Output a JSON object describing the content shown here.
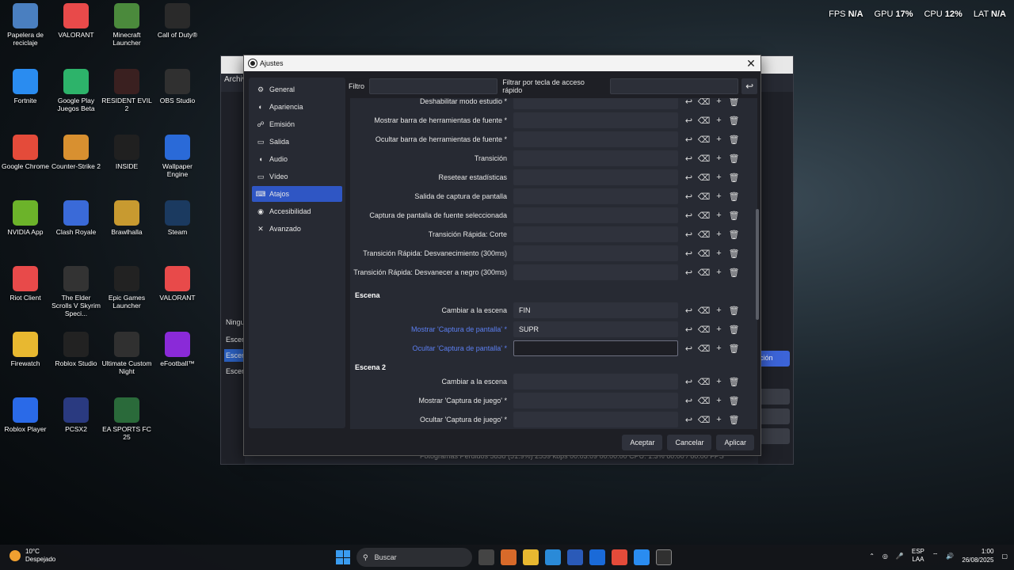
{
  "desktop": {
    "icons": [
      {
        "label": "Papelera de reciclaje",
        "color": "#4a7fc0"
      },
      {
        "label": "VALORANT",
        "color": "#e84a4a"
      },
      {
        "label": "Minecraft Launcher",
        "color": "#4b8a3c"
      },
      {
        "label": "Call of Duty®",
        "color": "#2a2a2a"
      },
      {
        "label": "Fortnite",
        "color": "#2a8cf0"
      },
      {
        "label": "Google Play Juegos Beta",
        "color": "#2db36a"
      },
      {
        "label": "RESIDENT EVIL 2",
        "color": "#3a2020"
      },
      {
        "label": "OBS Studio",
        "color": "#303030"
      },
      {
        "label": "Google Chrome",
        "color": "#e44b3a"
      },
      {
        "label": "Counter-Strike 2",
        "color": "#d89030"
      },
      {
        "label": "INSIDE",
        "color": "#202020"
      },
      {
        "label": "Wallpaper Engine",
        "color": "#2a6ad8"
      },
      {
        "label": "NVIDIA App",
        "color": "#6cb32a"
      },
      {
        "label": "Clash Royale",
        "color": "#3a6ad8"
      },
      {
        "label": "Brawlhalla",
        "color": "#c89a30"
      },
      {
        "label": "Steam",
        "color": "#1b3a60"
      },
      {
        "label": "Riot Client",
        "color": "#e84a4a"
      },
      {
        "label": "The Elder Scrolls V Skyrim Speci...",
        "color": "#333333"
      },
      {
        "label": "Epic Games Launcher",
        "color": "#222222"
      },
      {
        "label": "VALORANT",
        "color": "#e84a4a"
      },
      {
        "label": "Firewatch",
        "color": "#e8b830"
      },
      {
        "label": "Roblox Studio",
        "color": "#222222"
      },
      {
        "label": "Ultimate Custom Night",
        "color": "#303030"
      },
      {
        "label": "eFootball™",
        "color": "#8a2ad8"
      },
      {
        "label": "Roblox Player",
        "color": "#2a6ae8"
      },
      {
        "label": "PCSX2",
        "color": "#2a3a80"
      },
      {
        "label": "EA SPORTS FC 25",
        "color": "#2a6a3a"
      }
    ]
  },
  "perf": {
    "fps_label": "FPS",
    "fps_val": "N/A",
    "gpu_label": "GPU",
    "gpu_val": "17%",
    "cpu_label": "CPU",
    "cpu_val": "12%",
    "lat_label": "LAT",
    "lat_val": "N/A"
  },
  "obs_main": {
    "menu": "Archiv",
    "scenes_label": "Escen",
    "ninguna": "Ningu",
    "scene_items": [
      "Escen",
      "Escen"
    ],
    "action_btn": "ción",
    "status": "Fotogramas Perdidos 5838 (51.9%)    2559 kbps    00:03:09    00:00:00    CPU: 1.3%    60.00 / 60.00 FPS"
  },
  "dialog": {
    "title": "Ajustes",
    "close": "✕",
    "sidebar": [
      {
        "label": "General",
        "icon": "gear-icon"
      },
      {
        "label": "Apariencia",
        "icon": "palette-icon"
      },
      {
        "label": "Emisión",
        "icon": "broadcast-icon"
      },
      {
        "label": "Salida",
        "icon": "output-icon"
      },
      {
        "label": "Audio",
        "icon": "speaker-icon"
      },
      {
        "label": "Vídeo",
        "icon": "monitor-icon"
      },
      {
        "label": "Atajos",
        "icon": "keyboard-icon"
      },
      {
        "label": "Accesibilidad",
        "icon": "accessibility-icon"
      },
      {
        "label": "Avanzado",
        "icon": "tools-icon"
      }
    ],
    "active_section": "Atajos",
    "filter_label": "Filtro",
    "filter_hotkey_label": "Filtrar por tecla de acceso rápido",
    "hotkeys": [
      {
        "label": "Deshabilitar modo estudio *",
        "key": ""
      },
      {
        "label": "Mostrar barra de herramientas de fuente *",
        "key": ""
      },
      {
        "label": "Ocultar barra de herramientas de fuente *",
        "key": ""
      },
      {
        "label": "Transición",
        "key": ""
      },
      {
        "label": "Resetear estadísticas",
        "key": ""
      },
      {
        "label": "Salida de captura de pantalla",
        "key": ""
      },
      {
        "label": "Captura de pantalla de fuente seleccionada",
        "key": ""
      },
      {
        "label": "Transición Rápida: Corte",
        "key": ""
      },
      {
        "label": "Transición Rápida: Desvanecimiento (300ms)",
        "key": ""
      },
      {
        "label": "Transición Rápida: Desvanecer a negro (300ms)",
        "key": ""
      }
    ],
    "section_escena": {
      "title": "Escena",
      "rows": [
        {
          "label": "Cambiar a la escena",
          "key": "FIN"
        },
        {
          "label": "Mostrar 'Captura de pantalla' *",
          "key": "SUPR"
        },
        {
          "label": "Ocultar 'Captura de pantalla' *",
          "key": ""
        }
      ]
    },
    "section_escena2": {
      "title": "Escena 2",
      "rows": [
        {
          "label": "Cambiar a la escena",
          "key": ""
        },
        {
          "label": "Mostrar 'Captura de juego' *",
          "key": ""
        },
        {
          "label": "Ocultar 'Captura de juego' *",
          "key": ""
        }
      ]
    },
    "buttons": {
      "accept": "Aceptar",
      "cancel": "Cancelar",
      "apply": "Aplicar"
    }
  },
  "taskbar": {
    "temp": "10°C",
    "weather": "Despejado",
    "search_placeholder": "Buscar",
    "lang1": "ESP",
    "lang2": "LAA",
    "time": "1:00",
    "date": "26/08/2025"
  }
}
